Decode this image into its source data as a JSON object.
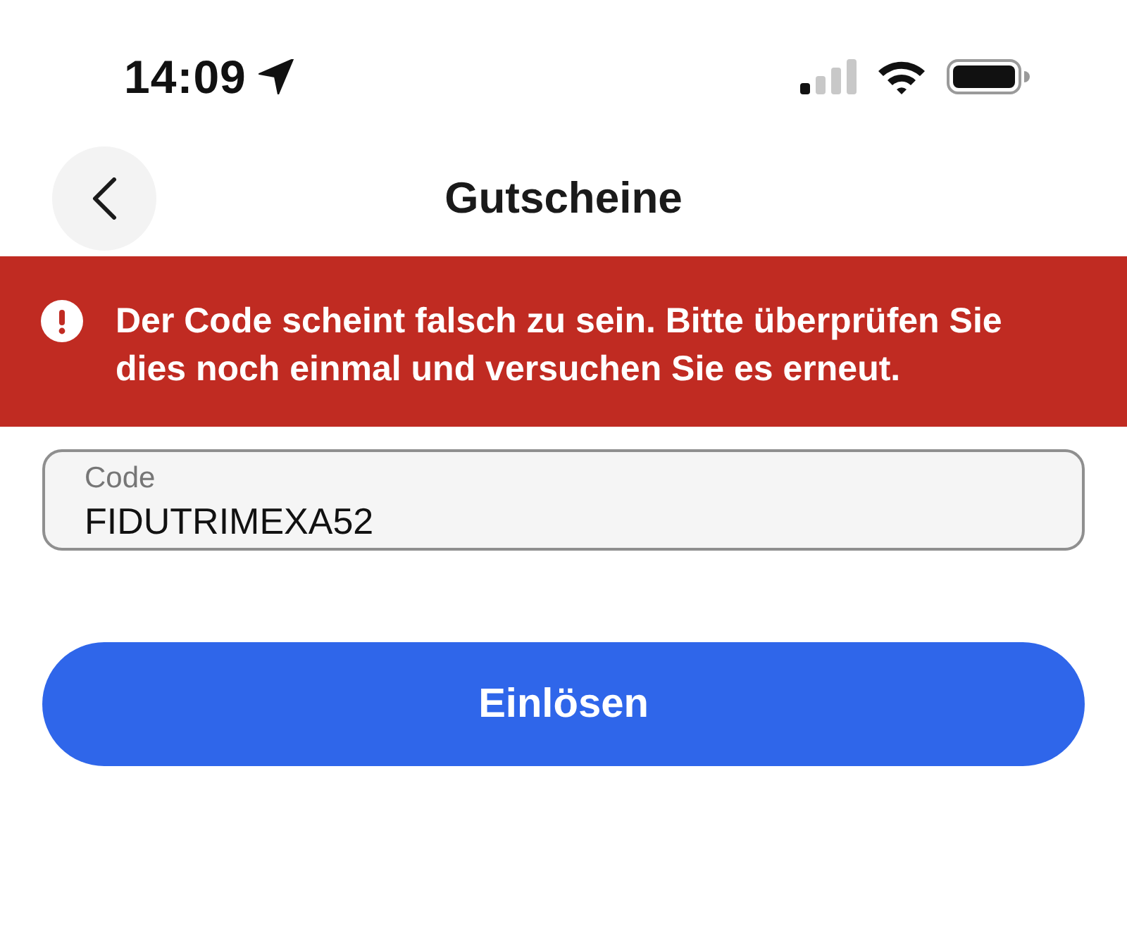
{
  "status_bar": {
    "time": "14:09"
  },
  "header": {
    "title": "Gutscheine"
  },
  "error_banner": {
    "message": "Der Code scheint falsch zu sein. Bitte überprüfen Sie dies noch einmal und versuchen Sie es erneut."
  },
  "code_field": {
    "label": "Code",
    "value": "FIDUTRIMEXA52"
  },
  "redeem_button": {
    "label": "Einlösen"
  }
}
